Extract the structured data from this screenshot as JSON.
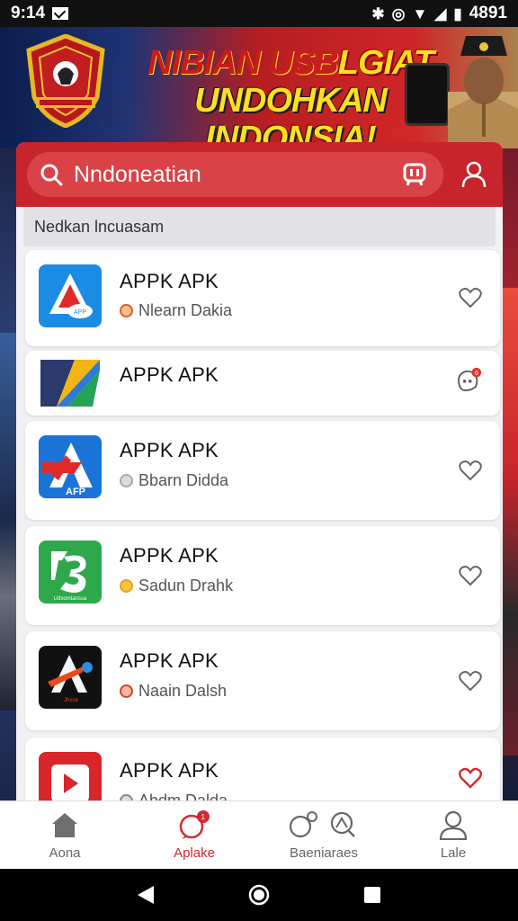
{
  "status_bar": {
    "time": "9:14",
    "battery": "4891"
  },
  "banner": {
    "line1_a": "NIBIAN USB",
    "line1_b": "LGIAT",
    "line2": "UNDOHKAN INDONSIA!"
  },
  "search": {
    "value": "Nndoneatian"
  },
  "section": {
    "label": "Nedkan lncuasam"
  },
  "apps": [
    {
      "name": "APPK APK",
      "developer": "Nlearn Dakia",
      "dev_color": "#e25a2a",
      "favorited": false
    },
    {
      "name": "APPK APK",
      "developer": "",
      "dev_color": "",
      "favorited": false,
      "has_badge": true
    },
    {
      "name": "APPK APK",
      "developer": "Bbarn Didda",
      "dev_color": "#aaaaaa",
      "favorited": false,
      "icon_label": "AFP"
    },
    {
      "name": "APPK APK",
      "developer": "Sadun Drahk",
      "dev_color": "#e8a21a",
      "favorited": false,
      "icon_label": "Udsomtanssa"
    },
    {
      "name": "APPK APK",
      "developer": "Naain Dalsh",
      "dev_color": "#d2442a",
      "favorited": false,
      "icon_label": "Jhsce"
    },
    {
      "name": "APPK APK",
      "developer": "Abdm Dalda",
      "dev_color": "#888888",
      "favorited": true
    }
  ],
  "bottom_nav": [
    {
      "label": "Aona",
      "icon": "home-icon",
      "active": false
    },
    {
      "label": "Aplake",
      "icon": "chat-icon",
      "active": true
    },
    {
      "label": "Baeniaraes",
      "icon": "discover-icon",
      "active": false
    },
    {
      "label": "Lale",
      "icon": "person-icon",
      "active": false
    }
  ],
  "colors": {
    "accent": "#c8242b",
    "active": "#d22a2f"
  }
}
